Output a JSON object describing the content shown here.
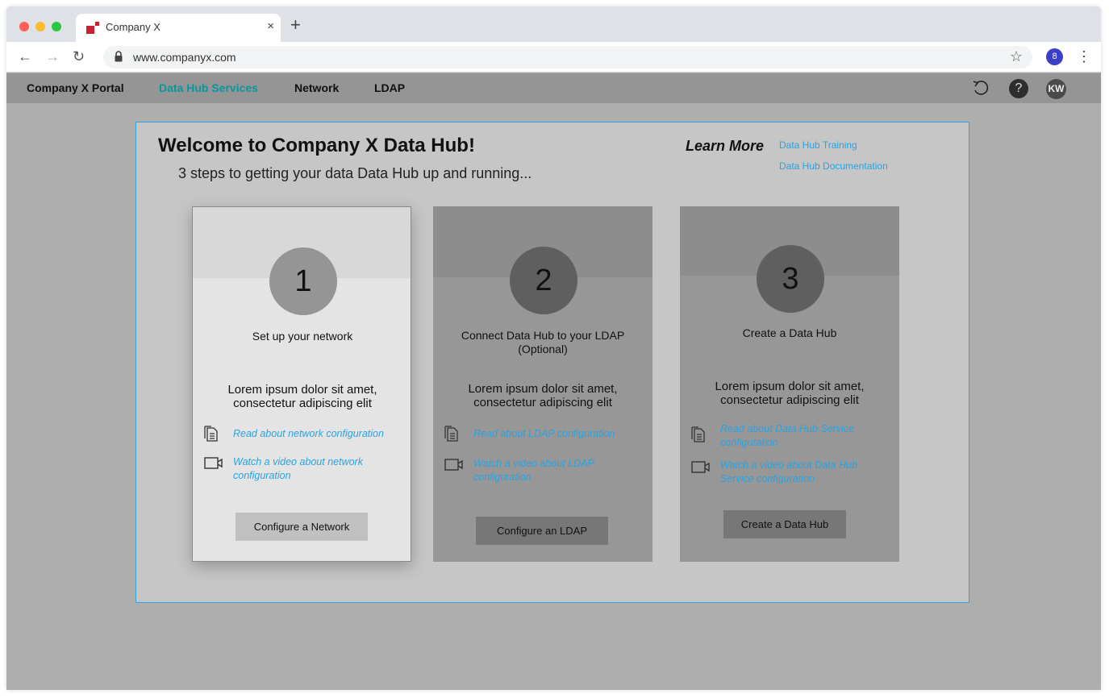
{
  "browser": {
    "tab_title": "Company X",
    "tab_close": "×",
    "new_tab": "+",
    "url": "www.companyx.com",
    "profile_initial": "8",
    "icons": [
      "back-icon",
      "forward-icon",
      "reload-icon",
      "lock-icon",
      "star-icon",
      "menu-icon"
    ]
  },
  "appbar": {
    "brand": "Company X Portal",
    "nav": [
      "Data Hub Services",
      "Network",
      "LDAP"
    ],
    "active_nav": "Data Hub Services",
    "active_color": "#08979c",
    "help_label": "?",
    "avatar_initials": "KW"
  },
  "main": {
    "title": "Welcome to Company X Data Hub!",
    "subtitle": "3 steps to getting your data Data Hub up and running...",
    "learn_more": {
      "label": "Learn More",
      "links": [
        "Data Hub Training",
        "Data Hub Documentation"
      ]
    },
    "accent_color": "#2aa3e0",
    "steps": [
      {
        "number": "1",
        "title": "Set up your network",
        "description": "Lorem ipsum dolor sit amet, consectetur adipiscing elit",
        "read_link": "Read about network configuration",
        "video_link": "Watch a video about network configuration",
        "button": "Configure a Network",
        "active": true
      },
      {
        "number": "2",
        "title": "Connect Data Hub to your LDAP (Optional)",
        "description": "Lorem ipsum dolor sit amet, consectetur adipiscing elit",
        "read_link": "Read about LDAP configuration",
        "video_link": "Watch a video about LDAP configuration",
        "button": "Configure an LDAP",
        "active": false
      },
      {
        "number": "3",
        "title": "Create a Data Hub",
        "description": "Lorem ipsum dolor sit amet, consectetur adipiscing elit",
        "read_link": "Read about Data Hub Service configuration",
        "video_link": "Watch a video about Data Hub Service configuration",
        "button": "Create a Data Hub",
        "active": false
      }
    ]
  }
}
